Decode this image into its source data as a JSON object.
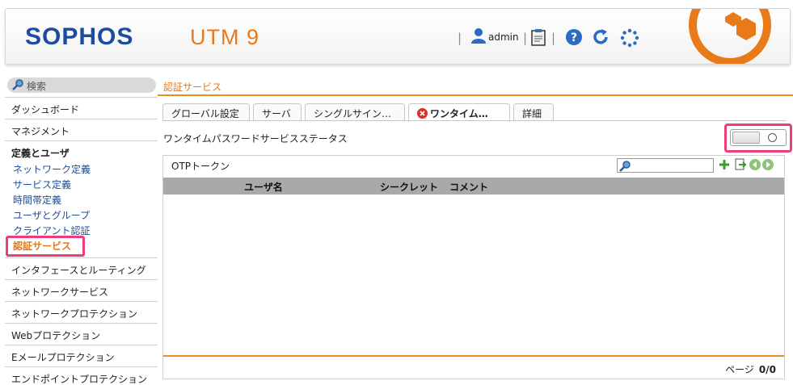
{
  "header": {
    "brand": "SOPHOS",
    "product": "UTM 9",
    "user": "admin",
    "icons": [
      "user-icon",
      "clipboard-icon",
      "help-icon",
      "refresh-icon",
      "spinner-icon",
      "sophos-logo-icon"
    ],
    "colors": {
      "brand_blue": "#1b4ca0",
      "accent_orange": "#e87a1a"
    }
  },
  "sidebar": {
    "search_placeholder": "検索",
    "items": [
      {
        "label": "ダッシュボード"
      },
      {
        "label": "マネジメント"
      }
    ],
    "group": {
      "title": "定義とユーザ",
      "subitems": [
        {
          "label": "ネットワーク定義"
        },
        {
          "label": "サービス定義"
        },
        {
          "label": "時間帯定義"
        },
        {
          "label": "ユーザとグループ"
        },
        {
          "label": "クライアント認証"
        },
        {
          "label": "認証サービス",
          "active": true
        }
      ]
    },
    "items_after": [
      {
        "label": "インタフェースとルーティング"
      },
      {
        "label": "ネットワークサービス"
      },
      {
        "label": "ネットワークプロテクション"
      },
      {
        "label": "Webプロテクション"
      },
      {
        "label": "Eメールプロテクション"
      },
      {
        "label": "エンドポイントプロテクション"
      }
    ]
  },
  "main": {
    "page_title": "認証サービス",
    "tabs": [
      {
        "label": "グローバル設定"
      },
      {
        "label": "サーバ"
      },
      {
        "label": "シングルサイン…"
      },
      {
        "label": "ワンタイム…",
        "active": true,
        "status_icon": "error-x-icon"
      },
      {
        "label": "詳細"
      }
    ],
    "status_label": "ワンタイムパスワードサービスステータス",
    "toggle": {
      "state": "off"
    },
    "otp_panel": {
      "title": "OTPトークン",
      "filter_value": "",
      "columns": [
        "ユーザ名",
        "シークレット",
        "コメント"
      ],
      "rows": [],
      "pager": {
        "label": "ページ",
        "value": "0/0"
      }
    }
  }
}
